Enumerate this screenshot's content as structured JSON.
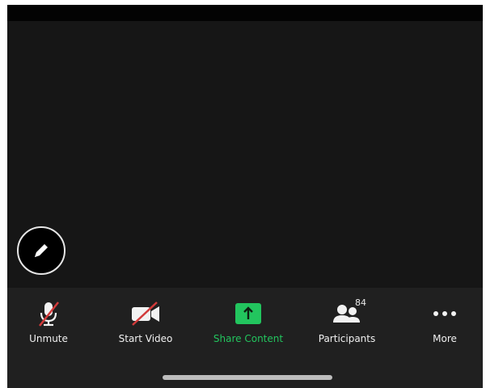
{
  "toolbar": {
    "unmute_label": "Unmute",
    "start_video_label": "Start Video",
    "share_content_label": "Share Content",
    "participants_label": "Participants",
    "participants_count": "84",
    "more_label": "More"
  },
  "colors": {
    "accent_green": "#22c55e",
    "muted_slash": "#d23a3a",
    "toolbar_bg": "#202020"
  },
  "icons": {
    "annotate": "pencil-icon",
    "unmute": "microphone-muted-icon",
    "start_video": "camera-off-icon",
    "share": "share-arrow-icon",
    "participants": "people-icon",
    "more": "ellipsis-icon"
  }
}
